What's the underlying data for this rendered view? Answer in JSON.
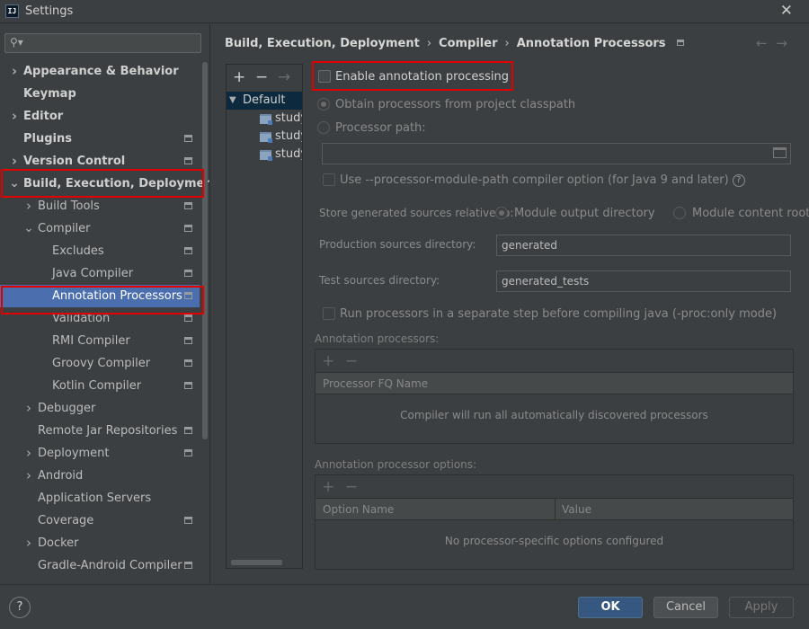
{
  "window": {
    "title": "Settings",
    "app_icon_text": "IJ"
  },
  "sidebar": {
    "search_placeholder": "",
    "items": [
      {
        "label": "Appearance & Behavior",
        "bold": true,
        "arrow": "right",
        "indent": 0
      },
      {
        "label": "Keymap",
        "bold": true,
        "indent": 0
      },
      {
        "label": "Editor",
        "bold": true,
        "arrow": "right",
        "indent": 0
      },
      {
        "label": "Plugins",
        "bold": true,
        "indent": 0,
        "marker": true
      },
      {
        "label": "Version Control",
        "bold": true,
        "arrow": "right",
        "indent": 0,
        "marker": true
      },
      {
        "label": "Build, Execution, Deployment",
        "bold": true,
        "arrow": "down",
        "indent": 0
      },
      {
        "label": "Build Tools",
        "arrow": "right",
        "indent": 1,
        "marker": true
      },
      {
        "label": "Compiler",
        "arrow": "down",
        "indent": 1,
        "marker": true
      },
      {
        "label": "Excludes",
        "indent": 2,
        "marker": true
      },
      {
        "label": "Java Compiler",
        "indent": 2,
        "marker": true
      },
      {
        "label": "Annotation Processors",
        "indent": 2,
        "marker": true,
        "selected": true
      },
      {
        "label": "Validation",
        "indent": 2,
        "marker": true
      },
      {
        "label": "RMI Compiler",
        "indent": 2,
        "marker": true
      },
      {
        "label": "Groovy Compiler",
        "indent": 2,
        "marker": true
      },
      {
        "label": "Kotlin Compiler",
        "indent": 2,
        "marker": true
      },
      {
        "label": "Debugger",
        "arrow": "right",
        "indent": 1
      },
      {
        "label": "Remote Jar Repositories",
        "indent": 1,
        "marker": true
      },
      {
        "label": "Deployment",
        "arrow": "right",
        "indent": 1,
        "marker": true
      },
      {
        "label": "Android",
        "arrow": "right",
        "indent": 1
      },
      {
        "label": "Application Servers",
        "indent": 1
      },
      {
        "label": "Coverage",
        "indent": 1,
        "marker": true
      },
      {
        "label": "Docker",
        "arrow": "right",
        "indent": 1
      },
      {
        "label": "Gradle-Android Compiler",
        "indent": 1,
        "marker": true
      }
    ]
  },
  "breadcrumb": [
    "Build, Execution, Deployment",
    "Compiler",
    "Annotation Processors"
  ],
  "nav": {
    "back": "←",
    "forward": "→"
  },
  "profiles": {
    "toolbar": {
      "add": "+",
      "remove": "−",
      "move": "→"
    },
    "default_label": "Default",
    "modules": [
      "study",
      "study",
      "study"
    ]
  },
  "form": {
    "enable_label": "Enable annotation processing",
    "obtain_label": "Obtain processors from project classpath",
    "processor_path_label": "Processor path:",
    "processor_path_value": "",
    "module_path_label": "Use --processor-module-path compiler option (for Java 9 and later)",
    "store_label": "Store generated sources relative to:",
    "module_output_label": "Module output directory",
    "module_content_label": "Module content root",
    "prod_dir_label": "Production sources directory:",
    "prod_dir_value": "generated",
    "test_dir_label": "Test sources directory:",
    "test_dir_value": "generated_tests",
    "separate_step_label": "Run processors in a separate step before compiling java (-proc:only mode)"
  },
  "processors_table": {
    "title": "Annotation processors:",
    "add": "+",
    "remove": "−",
    "column": "Processor FQ Name",
    "empty_text": "Compiler will run all automatically discovered processors"
  },
  "options_table": {
    "title": "Annotation processor options:",
    "add": "+",
    "remove": "−",
    "columns": [
      "Option Name",
      "Value"
    ],
    "empty_text": "No processor-specific options configured"
  },
  "footer": {
    "help": "?",
    "ok": "OK",
    "cancel": "Cancel",
    "apply": "Apply"
  },
  "colors": {
    "selection": "#4b6eaf",
    "highlight_border": "#e10000",
    "primary_button": "#365880"
  }
}
